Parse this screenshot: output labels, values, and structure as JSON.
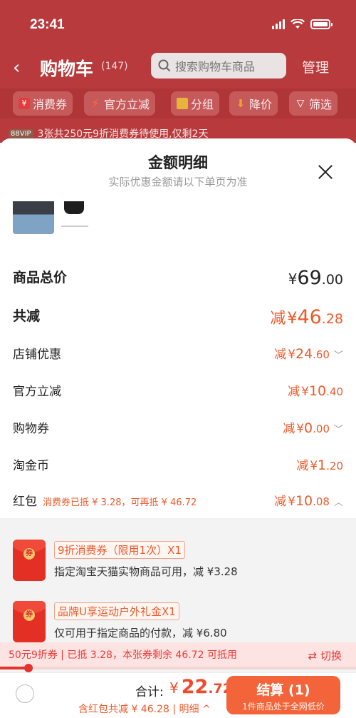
{
  "status_bar": {
    "time": "23:41"
  },
  "cart_header": {
    "back_icon": "chevron-left-icon",
    "title": "购物车",
    "count": "(147)",
    "search_placeholder": "搜索购物车商品",
    "manage_label": "管理"
  },
  "filter_chips": [
    {
      "label": "消费券",
      "icon": "coupon-icon"
    },
    {
      "label": "官方立减",
      "icon": "lightning-icon"
    },
    {
      "label": "分组",
      "icon": "folder-icon"
    },
    {
      "label": "降价",
      "icon": "arrow-down-icon"
    },
    {
      "label": "筛选",
      "icon": "filter-icon"
    }
  ],
  "promo": {
    "vip": "88VIP",
    "text": "3张共250元9折消费券待使用,仅剩2天"
  },
  "sheet": {
    "title": "金额明细",
    "subtitle": "实际优惠金额请以下单页为准"
  },
  "breakdown": {
    "total": {
      "label": "商品总价",
      "yen": "¥",
      "int": "69",
      "dec": ".00"
    },
    "reduce": {
      "label": "共减",
      "prefix": "减",
      "yen": "¥",
      "int": "46",
      "dec": ".28"
    },
    "shop": {
      "label": "店铺优惠",
      "prefix": "减",
      "yen": "¥",
      "int": "24",
      "dec": ".60"
    },
    "official": {
      "label": "官方立减",
      "prefix": "减",
      "yen": "¥",
      "int": "10",
      "dec": ".40"
    },
    "voucher": {
      "label": "购物券",
      "prefix": "减",
      "yen": "¥",
      "int": "0",
      "dec": ".00"
    },
    "coins": {
      "label": "淘金币",
      "prefix": "减",
      "yen": "¥",
      "int": "1",
      "dec": ".20"
    },
    "redpacket": {
      "label": "红包",
      "note": "消费券已抵 ¥ 3.28，可再抵 ¥ 46.72",
      "prefix": "减",
      "yen": "¥",
      "int": "10",
      "dec": ".08"
    }
  },
  "coupons": [
    {
      "name": "9折消费券（限用1次）X1",
      "desc": "指定淘宝天猫实物商品可用，减 ¥3.28",
      "seal": "券"
    },
    {
      "name": "品牌U享运动户外礼金X1",
      "desc": "仅可用于指定商品的付款，减 ¥6.80",
      "seal": "券"
    }
  ],
  "coupon_banner": {
    "text": "50元9折券 | 已抵 3.28，本张券剩余 46.72 可抵用",
    "switch_label": "⇄ 切换",
    "progress": 0.08
  },
  "checkout": {
    "sum_label": "合计:",
    "yen": "¥",
    "int": "22",
    "dec": ".72",
    "sub": "含红包共减 ¥ 46.28 | 明细 ^",
    "button_label": "结算 (1)",
    "button_sub": "1件商品处于全网低价"
  },
  "colors": {
    "accent": "#ee5a2b",
    "header": "#b83a3c",
    "checkout": "#f3643a"
  }
}
